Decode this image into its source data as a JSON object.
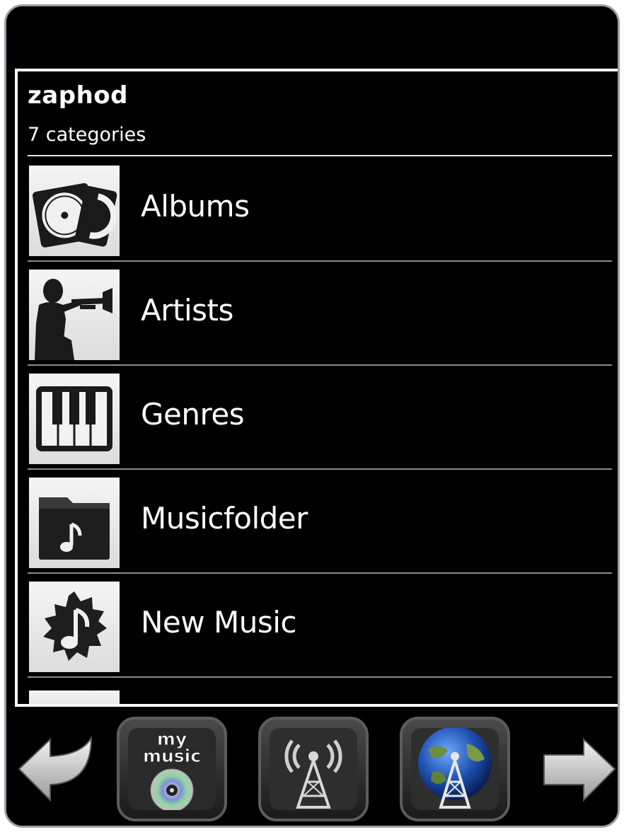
{
  "header": {
    "server_name": "zaphod",
    "category_count": "7 categories"
  },
  "categories": [
    {
      "label": "Albums",
      "icon": "albums-icon"
    },
    {
      "label": "Artists",
      "icon": "artists-icon"
    },
    {
      "label": "Genres",
      "icon": "genres-icon"
    },
    {
      "label": "Musicfolder",
      "icon": "musicfolder-icon"
    },
    {
      "label": "New Music",
      "icon": "new-music-icon"
    }
  ],
  "toolbar": {
    "my_music_label": "my music",
    "my_music_line1": "my",
    "my_music_line2": "music",
    "buttons": [
      "back-arrow-icon",
      "my-music-icon",
      "local-radio-icon",
      "internet-radio-icon",
      "forward-arrow-icon"
    ]
  },
  "colors": {
    "background": "#000000",
    "text": "#ffffff",
    "frame": "#9aa0a8",
    "divider": "#8c8c8c"
  }
}
